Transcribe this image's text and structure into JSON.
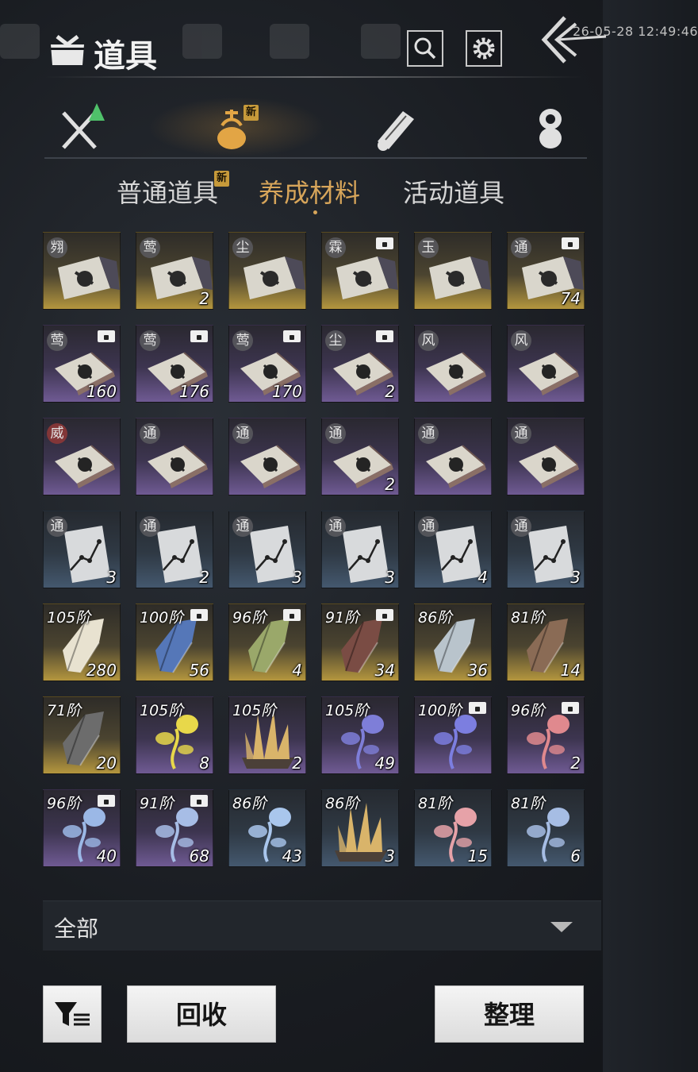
{
  "status": {
    "time": "26-05-28 12:49:46"
  },
  "header": {
    "title": "道具"
  },
  "category_tabs": [
    {
      "name": "equipment",
      "icon": "sword-icon"
    },
    {
      "name": "items",
      "icon": "pouch-icon",
      "active": true,
      "new": "新"
    },
    {
      "name": "scrolls",
      "icon": "scroll-icon"
    },
    {
      "name": "currency",
      "icon": "coin-stack-icon"
    }
  ],
  "sub_tabs": [
    {
      "label": "普通道具",
      "new": "新"
    },
    {
      "label": "养成材料",
      "active": true
    },
    {
      "label": "活动道具"
    }
  ],
  "grid": [
    [
      {
        "kind": "skill_map",
        "bg": "gold",
        "tag": "翙"
      },
      {
        "kind": "skill_map",
        "bg": "gold",
        "tag": "莺",
        "count": "2"
      },
      {
        "kind": "skill_map",
        "bg": "gold",
        "tag": "尘"
      },
      {
        "kind": "skill_map",
        "bg": "gold",
        "tag": "霖",
        "lock": true
      },
      {
        "kind": "skill_map",
        "bg": "gold",
        "tag": "玉"
      },
      {
        "kind": "skill_map",
        "bg": "gold",
        "tag": "通",
        "lock": true,
        "count": "74"
      }
    ],
    [
      {
        "kind": "book",
        "bg": "purple",
        "tag": "莺",
        "lock": true,
        "count": "160"
      },
      {
        "kind": "book",
        "bg": "purple",
        "tag": "莺",
        "lock": true,
        "count": "176"
      },
      {
        "kind": "book",
        "bg": "purple",
        "tag": "莺",
        "lock": true,
        "count": "170"
      },
      {
        "kind": "book",
        "bg": "purple",
        "tag": "尘",
        "lock": true,
        "count": "2"
      },
      {
        "kind": "book",
        "bg": "purple",
        "tag": "风"
      },
      {
        "kind": "book",
        "bg": "purple",
        "tag": "风"
      }
    ],
    [
      {
        "kind": "book",
        "bg": "purple",
        "tag": "威",
        "tag_color": "red"
      },
      {
        "kind": "book",
        "bg": "purple",
        "tag": "通"
      },
      {
        "kind": "book",
        "bg": "purple",
        "tag": "通"
      },
      {
        "kind": "book",
        "bg": "purple",
        "tag": "通",
        "count": "2"
      },
      {
        "kind": "book",
        "bg": "purple",
        "tag": "通"
      },
      {
        "kind": "book",
        "bg": "purple",
        "tag": "通"
      }
    ],
    [
      {
        "kind": "chart",
        "bg": "blue",
        "tag": "通",
        "count": "3"
      },
      {
        "kind": "chart",
        "bg": "blue",
        "tag": "通",
        "count": "2"
      },
      {
        "kind": "chart",
        "bg": "blue",
        "tag": "通",
        "count": "3"
      },
      {
        "kind": "chart",
        "bg": "blue",
        "tag": "通",
        "count": "3"
      },
      {
        "kind": "chart",
        "bg": "blue",
        "tag": "通",
        "count": "4"
      },
      {
        "kind": "chart",
        "bg": "blue",
        "tag": "通",
        "count": "3"
      }
    ],
    [
      {
        "kind": "shard",
        "bg": "gold",
        "tier": "105阶",
        "count": "280",
        "color": "#e8e2d0"
      },
      {
        "kind": "shard",
        "bg": "gold",
        "tier": "100阶",
        "lock": true,
        "count": "56",
        "color": "#5577b8"
      },
      {
        "kind": "shard",
        "bg": "gold",
        "tier": "96阶",
        "lock": true,
        "count": "4",
        "color": "#9aa86a"
      },
      {
        "kind": "shard",
        "bg": "gold",
        "tier": "91阶",
        "lock": true,
        "count": "34",
        "color": "#7a4c44"
      },
      {
        "kind": "shard",
        "bg": "gold",
        "tier": "86阶",
        "count": "36",
        "color": "#b9c4cc"
      },
      {
        "kind": "shard",
        "bg": "gold",
        "tier": "81阶",
        "count": "14",
        "color": "#8a6b55"
      }
    ],
    [
      {
        "kind": "shard",
        "bg": "gold",
        "tier": "71阶",
        "count": "20",
        "color": "#6c6c6c"
      },
      {
        "kind": "flower",
        "bg": "purple",
        "tier": "105阶",
        "count": "8",
        "color": "#e8d84a"
      },
      {
        "kind": "crystal",
        "bg": "purple",
        "tier": "105阶",
        "count": "2",
        "color": "#d9b46a"
      },
      {
        "kind": "flower",
        "bg": "purple",
        "tier": "105阶",
        "count": "49",
        "color": "#7e7ed8"
      },
      {
        "kind": "flower",
        "bg": "purple",
        "tier": "100阶",
        "lock": true,
        "color": "#7c7ee0"
      },
      {
        "kind": "flower",
        "bg": "purple",
        "tier": "96阶",
        "lock": true,
        "count": "2",
        "color": "#e0898e"
      }
    ],
    [
      {
        "kind": "flower",
        "bg": "purple",
        "tier": "96阶",
        "lock": true,
        "count": "40",
        "color": "#9bb8e6"
      },
      {
        "kind": "flower",
        "bg": "purple",
        "tier": "91阶",
        "lock": true,
        "count": "68",
        "color": "#a7bde6"
      },
      {
        "kind": "flower",
        "bg": "blue",
        "tier": "86阶",
        "count": "43",
        "color": "#a9c6ec"
      },
      {
        "kind": "crystal",
        "bg": "blue",
        "tier": "86阶",
        "count": "3",
        "color": "#d9b46a"
      },
      {
        "kind": "flower",
        "bg": "blue",
        "tier": "81阶",
        "count": "15",
        "color": "#e6a2a8"
      },
      {
        "kind": "flower",
        "bg": "blue",
        "tier": "81阶",
        "count": "6",
        "color": "#a6bde4"
      }
    ]
  ],
  "filter": {
    "selected": "全部"
  },
  "actions": {
    "recycle": "回收",
    "sort": "整理"
  },
  "colors": {
    "accent": "#d7a55a",
    "new_badge": "#c79a3a"
  }
}
